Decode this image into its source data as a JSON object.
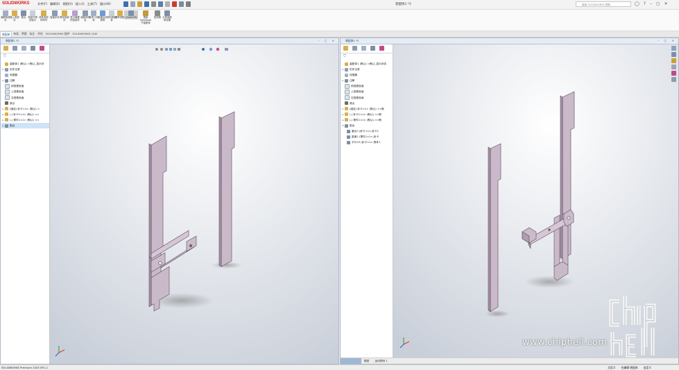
{
  "app": {
    "logo_text": "SOLIDWORKS",
    "window_title": "装配体1 *2",
    "search_placeholder": "搜索 SOLIDWORKS 帮助"
  },
  "menu": [
    "文件(F)",
    "编辑(E)",
    "视图(V)",
    "插入(I)",
    "工具(T)",
    "窗口(W)"
  ],
  "commands": [
    {
      "label": "编辑零部件",
      "icon": "edit-component-icon"
    },
    {
      "label": "插入零部件",
      "icon": "insert-component-icon"
    },
    {
      "label": "配合",
      "icon": "mate-icon"
    },
    {
      "label": "零部件预览窗口",
      "icon": "component-preview-icon"
    },
    {
      "label": "线性零部件阵列",
      "icon": "linear-pattern-icon"
    },
    {
      "label": "智能扣件",
      "icon": "smart-fastener-icon"
    },
    {
      "label": "移动零部件",
      "icon": "move-component-icon"
    },
    {
      "label": "显示隐藏的零部件",
      "icon": "show-hidden-icon"
    },
    {
      "label": "装配体特征",
      "icon": "assembly-feature-icon"
    },
    {
      "label": "参考几何体",
      "icon": "reference-geometry-icon"
    },
    {
      "label": "新建运动算例",
      "icon": "motion-study-icon"
    },
    {
      "label": "材料明细表",
      "icon": "bom-icon"
    },
    {
      "label": "爆炸视图",
      "icon": "exploded-view-icon"
    },
    {
      "label": "Instant3D",
      "icon": "instant3d-icon"
    },
    {
      "label": "更新 Speedpak 子装配体",
      "icon": "speedpak-icon"
    },
    {
      "label": "拍快照",
      "icon": "snapshot-icon"
    },
    {
      "label": "大型装配体设置",
      "icon": "large-assembly-icon"
    }
  ],
  "ribbon_tabs": [
    "装配体",
    "布局",
    "草图",
    "标注",
    "评估",
    "SOLIDWORKS 插件",
    "SOLIDWORKS CAM"
  ],
  "left_pane": {
    "title": "装配体1 *2",
    "tree": [
      {
        "label": "装配体1 (默认) <默认_显示状",
        "icon": "assembly-icon",
        "expand": ""
      },
      {
        "label": "历史记录",
        "icon": "history-icon",
        "expand": "▸"
      },
      {
        "label": "传感器",
        "icon": "sensor-icon",
        "expand": ""
      },
      {
        "label": "注解",
        "icon": "annotation-icon",
        "expand": "▸"
      },
      {
        "label": "前视基准面",
        "icon": "plane-icon",
        "expand": ""
      },
      {
        "label": "上视基准面",
        "icon": "plane-icon",
        "expand": ""
      },
      {
        "label": "右视基准面",
        "icon": "plane-icon",
        "expand": ""
      },
      {
        "label": "原点",
        "icon": "origin-icon",
        "expand": ""
      },
      {
        "label": "(固定) 卧卡<1> (默认) <",
        "icon": "part-icon",
        "expand": "▸"
      },
      {
        "label": "(-) 卧卡1<1> (默认) <<",
        "icon": "part-icon",
        "expand": "▸"
      },
      {
        "label": "(-) 零件1<1> (默认) <<",
        "icon": "part-icon",
        "expand": "▸"
      },
      {
        "label": "配合",
        "icon": "mates-icon",
        "expand": "▸"
      }
    ],
    "bottom_tabs": []
  },
  "right_pane": {
    "title": "装配体1 *2",
    "tree": [
      {
        "label": "装配体1 (默认) <默认_显示状态",
        "icon": "assembly-icon",
        "expand": ""
      },
      {
        "label": "历史记录",
        "icon": "history-icon",
        "expand": "▸"
      },
      {
        "label": "传感器",
        "icon": "sensor-icon",
        "expand": ""
      },
      {
        "label": "注解",
        "icon": "annotation-icon",
        "expand": "▸"
      },
      {
        "label": "前视基准面",
        "icon": "plane-icon",
        "expand": ""
      },
      {
        "label": "上视基准面",
        "icon": "plane-icon",
        "expand": ""
      },
      {
        "label": "右视基准面",
        "icon": "plane-icon",
        "expand": ""
      },
      {
        "label": "原点",
        "icon": "origin-icon",
        "expand": ""
      },
      {
        "label": "(固定) 卧卡<1> (默认) <<默",
        "icon": "part-icon",
        "expand": "▸"
      },
      {
        "label": "(-) 卧卡1<1> (默认) <<默",
        "icon": "part-icon",
        "expand": "▸"
      },
      {
        "label": "(-) 零件1<1> (默认) <<默",
        "icon": "part-icon",
        "expand": "▸"
      },
      {
        "label": "配合",
        "icon": "mates-icon",
        "expand": "▾"
      },
      {
        "label": "重合2 (卧卡<1>,卧卡1",
        "icon": "coincident-mate-icon",
        "expand": ""
      },
      {
        "label": "距离2 (零件1<1>,卧卡",
        "icon": "distance-mate-icon",
        "expand": ""
      },
      {
        "label": "平行10 (卧卡<1>,零件1",
        "icon": "parallel-mate-icon",
        "expand": ""
      }
    ],
    "bottom_tabs": [
      "模型",
      "运动算例 1"
    ]
  },
  "statusbar": {
    "product": "SOLIDWORKS Premium 2025 SP1.2",
    "state1": "欠定义",
    "state2": "在编辑 装配体",
    "units": "自定义"
  },
  "watermark": {
    "site": "www.chiphell.com",
    "logo_text": "chip hell"
  },
  "colors": {
    "part": "#c8b8c8",
    "part_edge": "#5a4a5a",
    "accent": "#d6221d"
  }
}
